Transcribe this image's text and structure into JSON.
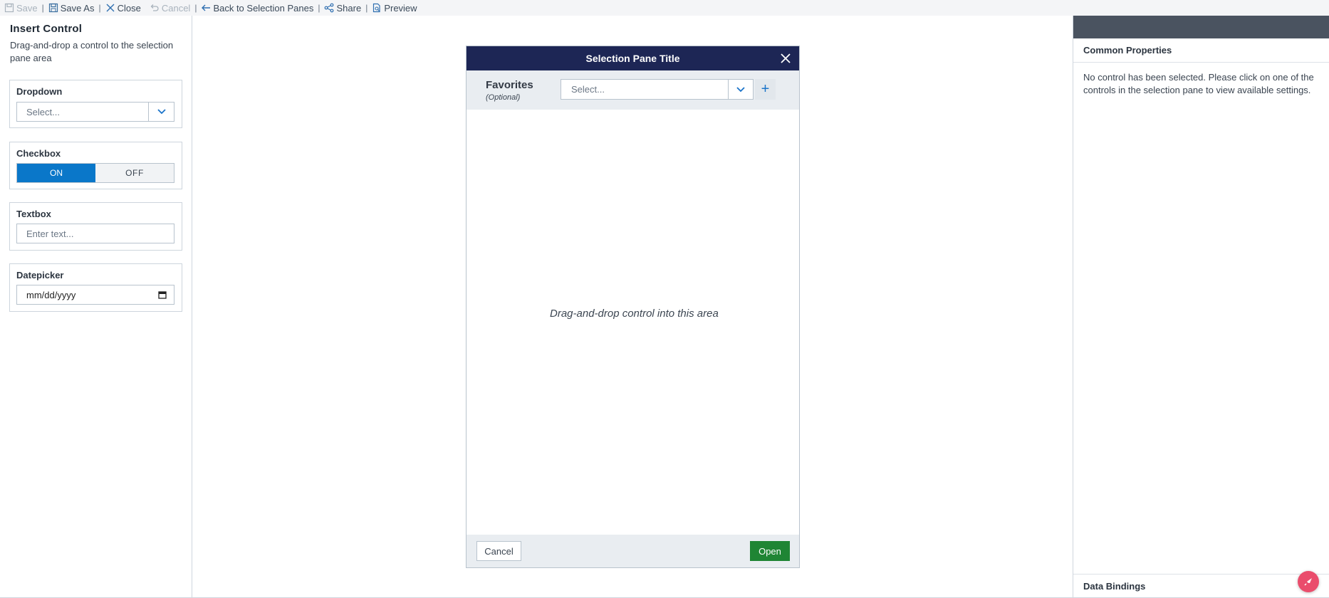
{
  "toolbar": {
    "save": "Save",
    "save_as": "Save As",
    "close": "Close",
    "cancel": "Cancel",
    "back": "Back to Selection Panes",
    "share": "Share",
    "preview": "Preview",
    "separator": "|"
  },
  "left_panel": {
    "title": "Insert Control",
    "description": "Drag-and-drop a control to the selection pane area",
    "dropdown": {
      "title": "Dropdown",
      "placeholder": "Select..."
    },
    "checkbox": {
      "title": "Checkbox",
      "on_label": "ON",
      "off_label": "OFF",
      "value": "ON"
    },
    "textbox": {
      "title": "Textbox",
      "placeholder": "Enter text..."
    },
    "datepicker": {
      "title": "Datepicker",
      "placeholder": "mm/dd/yyyy"
    }
  },
  "pane": {
    "title": "Selection Pane Title",
    "favorites_label": "Favorites",
    "favorites_optional": "(Optional)",
    "favorites_placeholder": "Select...",
    "add_symbol": "+",
    "drop_hint": "Drag-and-drop control into this area",
    "cancel_button": "Cancel",
    "open_button": "Open"
  },
  "right_panel": {
    "common_title": "Common Properties",
    "common_message": "No control has been selected. Please click on one of the controls in the selection pane to view available settings.",
    "data_bindings_title": "Data Bindings"
  },
  "colors": {
    "header_navy": "#1d2655",
    "accent_blue": "#0a77c9",
    "open_green": "#1f8534",
    "fab_pink": "#ea4d6c"
  }
}
